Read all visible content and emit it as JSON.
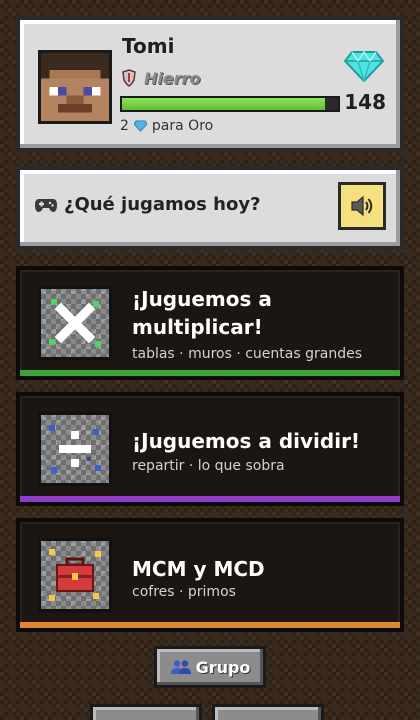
{
  "profile": {
    "name": "Tomi",
    "rank": "Hierro",
    "rank_icon": "shield-icon",
    "gems": "148",
    "gems_icon": "diamond-icon",
    "progress": 0.94,
    "next_rank_count": "2",
    "next_rank_label": "para Oro"
  },
  "question": {
    "text": "¿Qué jugamos hoy?",
    "icon": "gamepad-icon",
    "sound_icon": "speaker-icon"
  },
  "games": [
    {
      "title_line1": "¡Juguemos a",
      "title_line2": "multiplicar!",
      "subtitle": "tablas · muros · cuentas grandes",
      "icon": "multiply-icon",
      "accent": "#3ea33a"
    },
    {
      "title": "¡Juguemos a dividir!",
      "subtitle": "repartir · lo que sobra",
      "icon": "divide-icon",
      "accent": "#8e3cc9"
    },
    {
      "title": "MCM y MCD",
      "subtitle": "cofres · primos",
      "icon": "toolbox-icon",
      "accent": "#e0882a"
    }
  ],
  "footer": {
    "group_label": "Grupo",
    "group_icon": "group-icon"
  },
  "colors": {
    "background": "#3a2a1c",
    "panel": "#dcdcdc",
    "card": "#1c1613",
    "progress": "#6fcf3d",
    "diamond": "#4fe3e0",
    "sound_button": "#f5df7e"
  }
}
